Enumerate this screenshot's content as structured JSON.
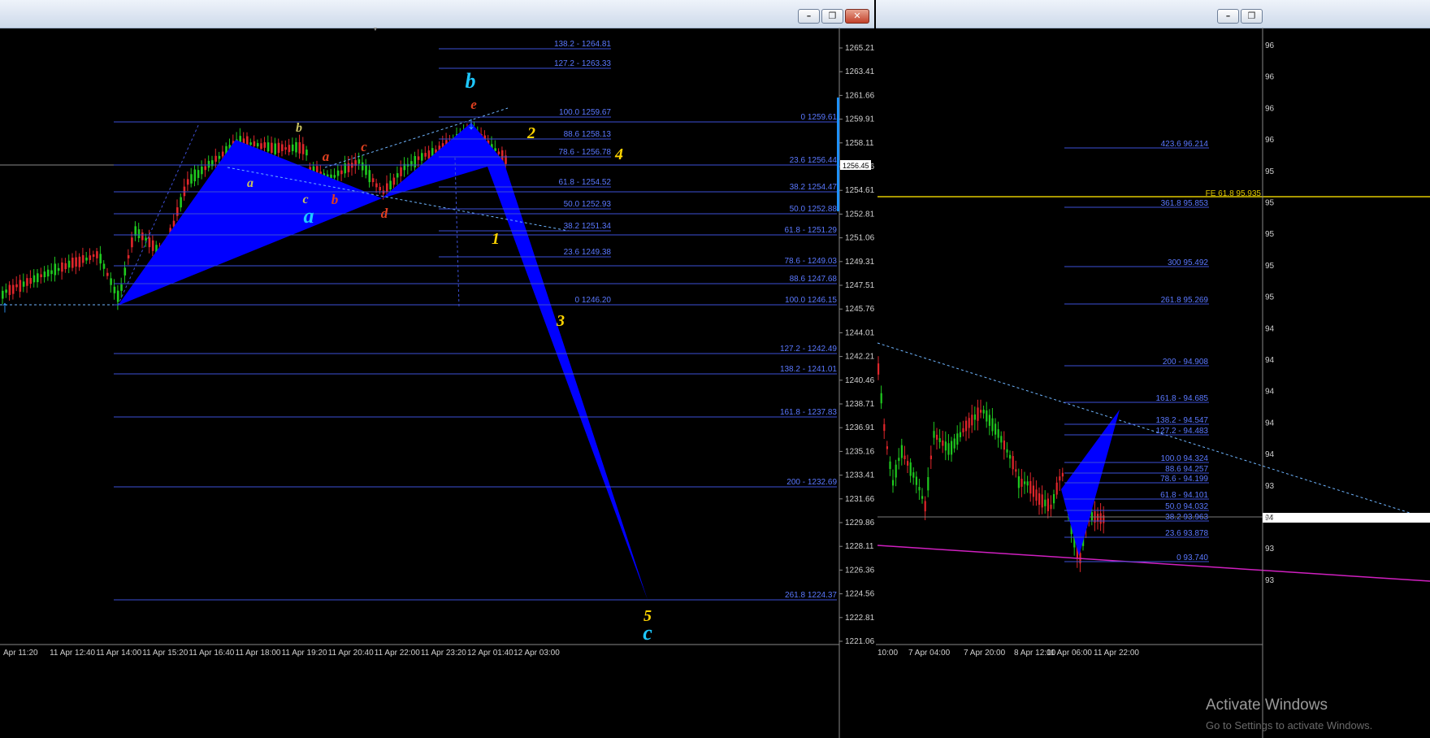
{
  "left_chart": {
    "price_axis": [
      "1265.21",
      "1263.41",
      "1261.66",
      "1259.91",
      "1258.11",
      "1256.36",
      "1254.61",
      "1252.81",
      "1251.06",
      "1249.31",
      "1247.51",
      "1245.76",
      "1244.01",
      "1242.21",
      "1240.46",
      "1238.71",
      "1236.91",
      "1235.16",
      "1233.41",
      "1231.66",
      "1229.86",
      "1228.11",
      "1226.36",
      "1224.56",
      "1222.81",
      "1221.06"
    ],
    "current_price": "1256.45",
    "time_axis": [
      "Apr 11:20",
      "11 Apr 12:40",
      "11 Apr 14:00",
      "11 Apr 15:20",
      "11 Apr 16:40",
      "11 Apr 18:00",
      "11 Apr 19:20",
      "11 Apr 20:40",
      "11 Apr 22:00",
      "11 Apr 23:20",
      "12 Apr 01:40",
      "12 Apr 03:00"
    ],
    "fib_upper": [
      "138.2 - 1264.81",
      "127.2 - 1263.33",
      "100.0 1259.67",
      "88.6 1258.13",
      "78.6 - 1256.78",
      "61.8 - 1254.52",
      "50.0 1252.93",
      "38.2 1251.34",
      "23.6 1249.38",
      "0 1246.20"
    ],
    "fib_right": [
      "0 1259.61",
      "23.6 1256.44",
      "38.2 1254.47",
      "50.0 1252.88",
      "61.8 - 1251.29",
      "78.6 - 1249.03",
      "88.6 1247.68",
      "100.0 1246.15",
      "127.2 - 1242.49",
      "138.2 - 1241.01",
      "161.8 - 1237.83",
      "200 - 1232.69",
      "261.8 1224.37"
    ],
    "wave_labels": {
      "a_small": "a",
      "b_small": "b",
      "c_small": "c",
      "a_big": "a",
      "a_red": "a",
      "b_red": "b",
      "c_red": "c",
      "d_red": "d",
      "e_red": "e",
      "b_big": "b",
      "w1": "1",
      "w2": "2",
      "w3": "3",
      "w4": "4",
      "w5": "5",
      "c_big": "c"
    }
  },
  "right_chart": {
    "time_axis": [
      "10:00",
      "7 Apr 04:00",
      "7 Apr 20:00",
      "8 Apr 12:00",
      "11 Apr 06:00",
      "11 Apr 22:00"
    ],
    "fe_line": "FE 61.8 95.935",
    "fib_labels": [
      "423.6 96.214",
      "361.8 95.853",
      "300 95.492",
      "261.8 95.269",
      "200 - 94.908",
      "161.8 - 94.685",
      "138.2 - 94.547",
      "127.2 - 94.483",
      "100.0 94.324",
      "88.6 94.257",
      "78.6 - 94.199",
      "61.8 - 94.101",
      "50.0 94.032",
      "38.2 93.963",
      "23.6 93.878",
      "0 93.740"
    ],
    "price_stub": "94",
    "axis_stub": [
      "96",
      "96",
      "96",
      "96",
      "95",
      "95",
      "95",
      "95",
      "95",
      "94",
      "94",
      "94",
      "94",
      "94",
      "93",
      "93",
      "93",
      "93"
    ]
  },
  "os": {
    "activate_title": "Activate Windows",
    "activate_sub": "Go to Settings to activate Windows."
  },
  "colors": {
    "pattern_fill": "#0000ff",
    "fib_line": "#3d4fd6",
    "fe_line": "#e0c800",
    "trend_line": "#d020c0",
    "bull_candle": "#1fc91f",
    "bear_candle": "#e0262b"
  }
}
